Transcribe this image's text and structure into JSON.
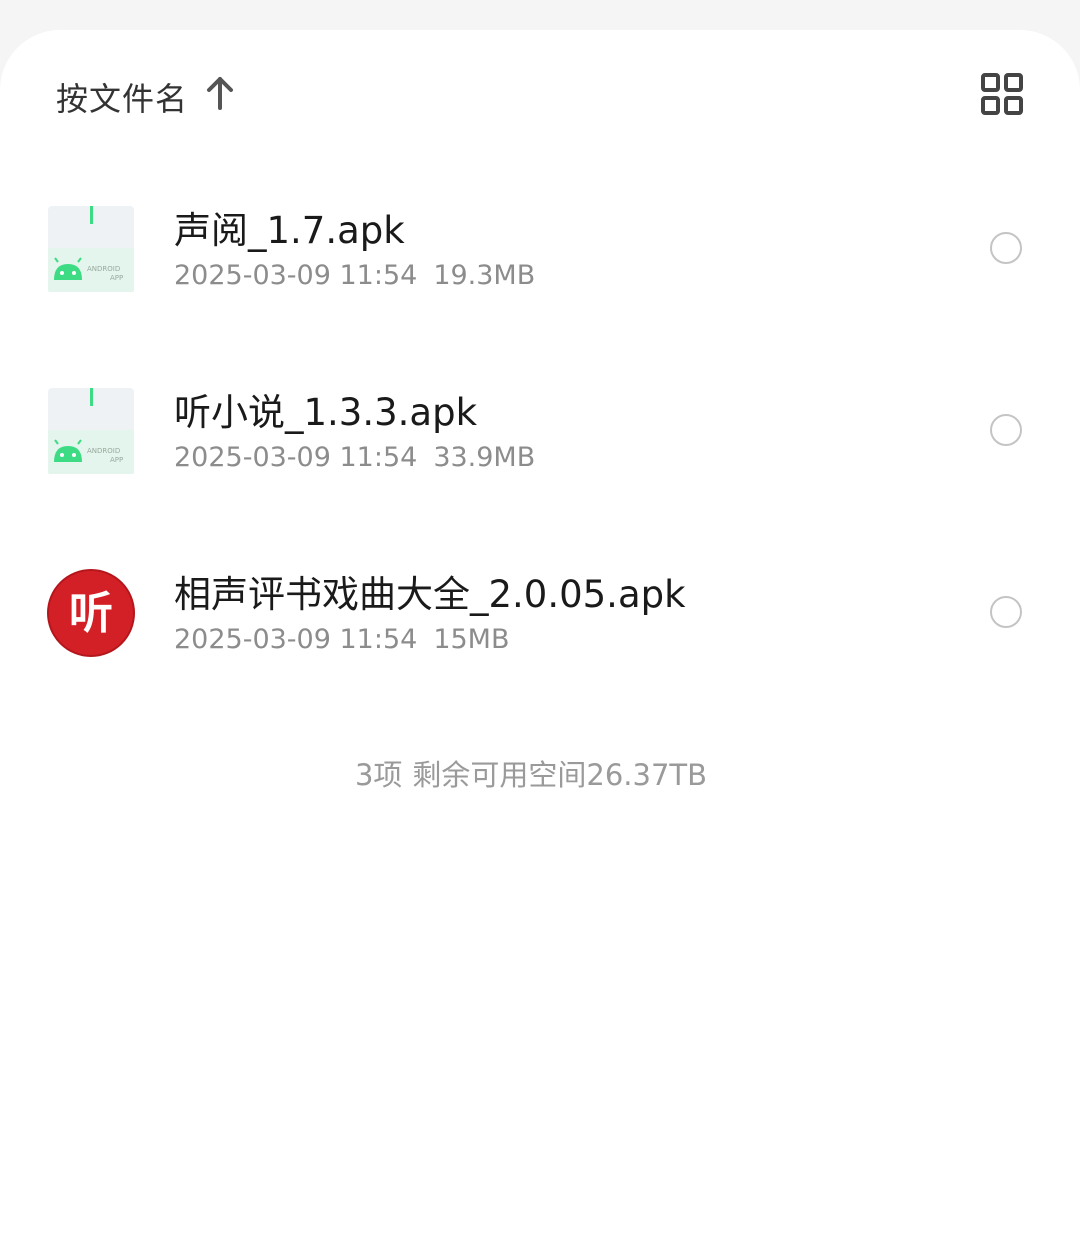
{
  "header": {
    "sort_label": "按文件名",
    "sort_arrow_icon": "arrow-up-icon",
    "view_toggle_icon": "grid-view-icon"
  },
  "files": [
    {
      "name": "声阅_1.7.apk",
      "date": "2025-03-09 11:54",
      "size": "19.3MB",
      "icon": "android-apk-icon",
      "icon_text_1": "ANDROID",
      "icon_text_2": "APP"
    },
    {
      "name": "听小说_1.3.3.apk",
      "date": "2025-03-09 11:54",
      "size": "33.9MB",
      "icon": "android-apk-icon",
      "icon_text_1": "ANDROID",
      "icon_text_2": "APP"
    },
    {
      "name": "相声评书戏曲大全_2.0.05.apk",
      "date": "2025-03-09 11:54",
      "size": "15MB",
      "icon": "app-logo-icon",
      "icon_text_1": "听"
    }
  ],
  "footer": {
    "count": "3项",
    "free_space": "剩余可用空间26.37TB"
  },
  "colors": {
    "android_green": "#3ddc84",
    "app_logo_red": "#d32027",
    "radio_border": "#c4c4c4",
    "secondary_text": "#8c8c8c"
  }
}
